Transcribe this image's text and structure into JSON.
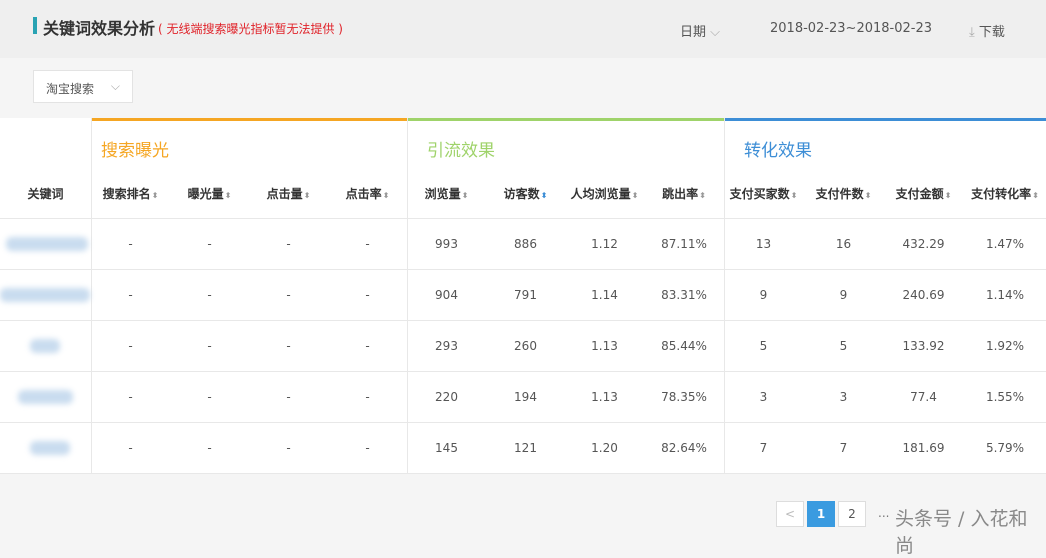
{
  "header": {
    "title": "关键词效果分析",
    "note": "( 无线端搜索曝光指标暂无法提供 )",
    "date_label": "日期",
    "date_range": "2018-02-23~2018-02-23",
    "download": "下载"
  },
  "filter": {
    "selected": "淘宝搜索"
  },
  "groups": [
    {
      "label": "搜索曝光",
      "color": "#f5a623"
    },
    {
      "label": "引流效果",
      "color": "#9fd36a"
    },
    {
      "label": "转化效果",
      "color": "#3d8ed6"
    }
  ],
  "columns": [
    "关键词",
    "搜索排名",
    "曝光量",
    "点击量",
    "点击率",
    "浏览量",
    "访客数",
    "人均浏览量",
    "跳出率",
    "支付买家数",
    "支付件数",
    "支付金额",
    "支付转化率"
  ],
  "sorted_column": "访客数",
  "rows": [
    [
      "-",
      "-",
      "-",
      "-",
      "993",
      "886",
      "1.12",
      "87.11%",
      "13",
      "16",
      "432.29",
      "1.47%"
    ],
    [
      "-",
      "-",
      "-",
      "-",
      "904",
      "791",
      "1.14",
      "83.31%",
      "9",
      "9",
      "240.69",
      "1.14%"
    ],
    [
      "-",
      "-",
      "-",
      "-",
      "293",
      "260",
      "1.13",
      "85.44%",
      "5",
      "5",
      "133.92",
      "1.92%"
    ],
    [
      "-",
      "-",
      "-",
      "-",
      "220",
      "194",
      "1.13",
      "78.35%",
      "3",
      "3",
      "77.4",
      "1.55%"
    ],
    [
      "-",
      "-",
      "-",
      "-",
      "145",
      "121",
      "1.20",
      "82.64%",
      "7",
      "7",
      "181.69",
      "5.79%"
    ]
  ],
  "pagination": {
    "prev": "<",
    "pages": [
      "1",
      "2"
    ],
    "ellipsis": "...",
    "current": "1"
  },
  "watermark": "头条号 / 入花和尚"
}
